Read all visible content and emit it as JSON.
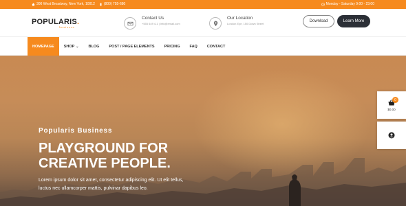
{
  "topbar": {
    "address": "300 West Broadway, New York, 10012",
    "phone": "(800) 755-680",
    "hours": "Monday - Saturday 9:00 - 23:00"
  },
  "header": {
    "logo": "POPULARIS",
    "logo_dot": ".",
    "logo_sub": "business",
    "contact": {
      "title": "Contact Us",
      "detail": "+555 649 4-1 | info@email.com"
    },
    "location": {
      "title": "Our Location",
      "detail": "London Eye, 150 Down Street"
    },
    "download_label": "Download",
    "learn_more_label": "Learn More"
  },
  "nav": {
    "items": [
      {
        "label": "HOMEPAGE",
        "active": true
      },
      {
        "label": "SHOP",
        "dropdown": true
      },
      {
        "label": "BLOG"
      },
      {
        "label": "POST / PAGE ELEMENTS"
      },
      {
        "label": "PRICING"
      },
      {
        "label": "FAQ"
      },
      {
        "label": "CONTACT"
      }
    ]
  },
  "hero": {
    "subtitle": "Popularis Business",
    "headline_line1": "PLAYGROUND FOR",
    "headline_line2": "CREATIVE PEOPLE.",
    "description": "Lorem ipsum dolor sit amet, consectetur adipiscing elit. Ut elit tellus, luctus nec ullamcorper mattis, pulvinar dapibus leo."
  },
  "widgets": {
    "cart_count": "0",
    "cart_price": "$0.00"
  },
  "colors": {
    "accent": "#f68a1e",
    "dark_button": "#2b2f36"
  }
}
